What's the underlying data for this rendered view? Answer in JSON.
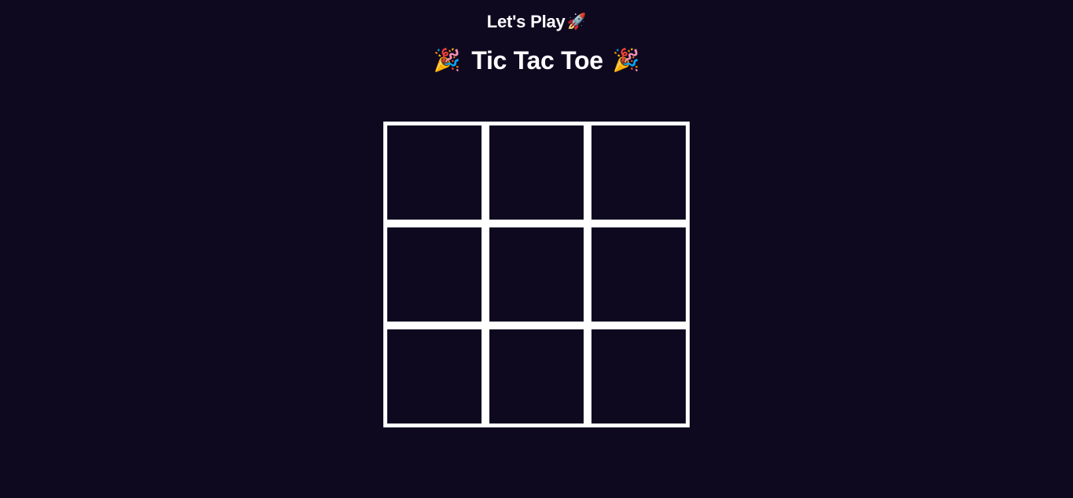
{
  "header": {
    "subtitle": "Let's Play",
    "subtitle_icon": "rocket-icon",
    "subtitle_emoji": "🚀",
    "title": "Tic Tac Toe",
    "title_icon": "party-popper-icon",
    "title_emoji": "🎉"
  },
  "board": {
    "rows": 3,
    "cols": 3,
    "cells": [
      "",
      "",
      "",
      "",
      "",
      "",
      "",
      "",
      ""
    ]
  },
  "colors": {
    "background": "#0f0920",
    "grid_lines": "#ffffff",
    "text": "#ffffff"
  }
}
